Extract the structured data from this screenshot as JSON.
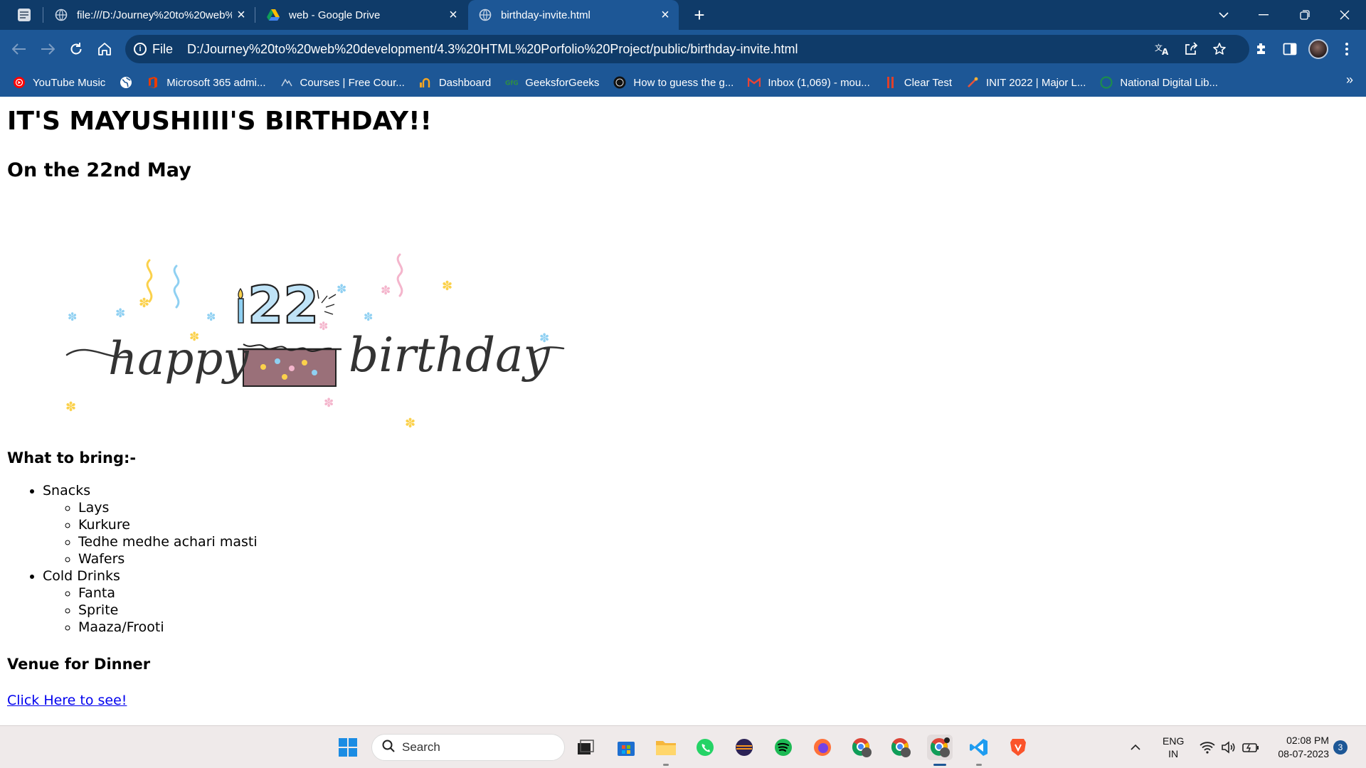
{
  "browser": {
    "tabs": [
      {
        "label": "file:///D:/Journey%20to%20web%",
        "icon": "globe-icon"
      },
      {
        "label": "web - Google Drive",
        "icon": "google-drive-icon"
      },
      {
        "label": "birthday-invite.html",
        "icon": "globe-icon"
      }
    ],
    "active_tab": 2,
    "address": {
      "scheme_label": "File",
      "url": "D:/Journey%20to%20web%20development/4.3%20HTML%20Porfolio%20Project/public/birthday-invite.html"
    },
    "bookmarks": [
      {
        "label": "YouTube Music",
        "icon": "youtube-music-icon"
      },
      {
        "label": "",
        "icon": "globe-icon"
      },
      {
        "label": "Microsoft 365 admi...",
        "icon": "office-icon"
      },
      {
        "label": "Courses | Free Cour...",
        "icon": "courses-icon"
      },
      {
        "label": "Dashboard",
        "icon": "dashboard-icon"
      },
      {
        "label": "GeeksforGeeks",
        "icon": "geeksforgeeks-icon"
      },
      {
        "label": "How to guess the g...",
        "icon": "video-icon"
      },
      {
        "label": "Inbox (1,069) - mou...",
        "icon": "gmail-icon"
      },
      {
        "label": "Clear Test",
        "icon": "cleartest-icon"
      },
      {
        "label": "INIT 2022 | Major L...",
        "icon": "init-icon"
      },
      {
        "label": "National Digital Lib...",
        "icon": "library-icon"
      }
    ],
    "colors": {
      "titlebar": "#0f3b69",
      "toolbar": "#1d5796"
    }
  },
  "page": {
    "heading": "IT'S MAYUSHIIII'S BIRTHDAY!!",
    "subheading": "On the 22nd May",
    "banner": {
      "number": "22",
      "word1": "happy",
      "word2": "birthday"
    },
    "bring_heading": "What to bring:-",
    "bring_list": [
      {
        "label": "Snacks",
        "items": [
          "Lays",
          "Kurkure",
          "Tedhe medhe achari masti",
          "Wafers"
        ]
      },
      {
        "label": "Cold Drinks",
        "items": [
          "Fanta",
          "Sprite",
          "Maaza/Frooti"
        ]
      }
    ],
    "venue_heading": "Venue for Dinner",
    "venue_link": "Click Here to see!"
  },
  "taskbar": {
    "search_placeholder": "Search",
    "language": {
      "line1": "ENG",
      "line2": "IN"
    },
    "time": "02:08 PM",
    "date": "08-07-2023",
    "notification_count": "3"
  }
}
